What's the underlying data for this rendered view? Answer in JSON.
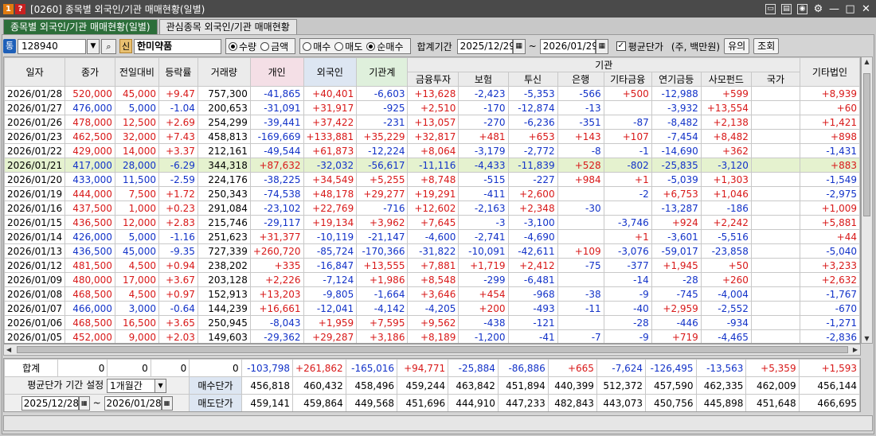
{
  "window": {
    "badge1": "1",
    "badge2": "?",
    "title": "[0260] 종목별 외국인/기관 매매현황(일별)"
  },
  "tabs": [
    {
      "label": "종목별 외국인/기관 매매현황(일별)"
    },
    {
      "label": "관심종목 외국인/기관 매매현황"
    }
  ],
  "toolbar": {
    "market_icon": "통",
    "code": "128940",
    "credit_badge": "신",
    "stock_name": "한미약품",
    "radio1": [
      {
        "label": "수량",
        "checked": true
      },
      {
        "label": "금액",
        "checked": false
      }
    ],
    "radio2": [
      {
        "label": "매수",
        "checked": false
      },
      {
        "label": "매도",
        "checked": false
      },
      {
        "label": "순매수",
        "checked": true
      }
    ],
    "period_label": "합계기간",
    "start_date": "2025/12/29",
    "tilde": "~",
    "end_date": "2026/01/29",
    "avg_price_check": "평균단가",
    "unit": "(주, 백만원)",
    "btn_caution": "유의",
    "btn_query": "조회"
  },
  "grid": {
    "headers": {
      "date": "일자",
      "close": "종가",
      "change": "전일대비",
      "rate": "등락률",
      "volume": "거래량",
      "individual": "개인",
      "foreign": "외국인",
      "institution": "기관계",
      "inst_group": "기관",
      "sub": [
        "금융투자",
        "보험",
        "투신",
        "은행",
        "기타금융",
        "연기금등",
        "사모펀드",
        "국가"
      ],
      "other_corp": "기타법인"
    },
    "rows": [
      {
        "date": "2026/01/28",
        "close": "520,000",
        "chg": "45,000",
        "rate": "+9.47",
        "vol": "757,300",
        "ind": "-41,865",
        "for": "+40,401",
        "inst": "-6,603",
        "fin": "+13,628",
        "ins": "-2,423",
        "inv": "-5,353",
        "bank": "-566",
        "ofin": "+500",
        "pen": "-12,988",
        "pef": "+599",
        "gov": "",
        "corp": "+8,939"
      },
      {
        "date": "2026/01/27",
        "close": "476,000",
        "chg": "5,000",
        "rate": "-1.04",
        "vol": "200,653",
        "ind": "-31,091",
        "for": "+31,917",
        "inst": "-925",
        "fin": "+2,510",
        "ins": "-170",
        "inv": "-12,874",
        "bank": "-13",
        "ofin": "",
        "pen": "-3,932",
        "pef": "+13,554",
        "gov": "",
        "corp": "+60"
      },
      {
        "date": "2026/01/26",
        "close": "478,000",
        "chg": "12,500",
        "rate": "+2.69",
        "vol": "254,299",
        "ind": "-39,441",
        "for": "+37,422",
        "inst": "-231",
        "fin": "+13,057",
        "ins": "-270",
        "inv": "-6,236",
        "bank": "-351",
        "ofin": "-87",
        "pen": "-8,482",
        "pef": "+2,138",
        "gov": "",
        "corp": "+1,421"
      },
      {
        "date": "2026/01/23",
        "close": "462,500",
        "chg": "32,000",
        "rate": "+7.43",
        "vol": "458,813",
        "ind": "-169,669",
        "for": "+133,881",
        "inst": "+35,229",
        "fin": "+32,817",
        "ins": "+481",
        "inv": "+653",
        "bank": "+143",
        "ofin": "+107",
        "pen": "-7,454",
        "pef": "+8,482",
        "gov": "",
        "corp": "+898"
      },
      {
        "date": "2026/01/22",
        "close": "429,000",
        "chg": "14,000",
        "rate": "+3.37",
        "vol": "212,161",
        "ind": "-49,544",
        "for": "+61,873",
        "inst": "-12,224",
        "fin": "+8,064",
        "ins": "-3,179",
        "inv": "-2,772",
        "bank": "-8",
        "ofin": "-1",
        "pen": "-14,690",
        "pef": "+362",
        "gov": "",
        "corp": "-1,431"
      },
      {
        "date": "2026/01/21",
        "close": "417,000",
        "chg": "28,000",
        "rate": "-6.29",
        "vol": "344,318",
        "ind": "+87,632",
        "for": "-32,032",
        "inst": "-56,617",
        "fin": "-11,116",
        "ins": "-4,433",
        "inv": "-11,839",
        "bank": "+528",
        "ofin": "-802",
        "pen": "-25,835",
        "pef": "-3,120",
        "gov": "",
        "corp": "+883"
      },
      {
        "date": "2026/01/20",
        "close": "433,000",
        "chg": "11,500",
        "rate": "-2.59",
        "vol": "224,176",
        "ind": "-38,225",
        "for": "+34,549",
        "inst": "+5,255",
        "fin": "+8,748",
        "ins": "-515",
        "inv": "-227",
        "bank": "+984",
        "ofin": "+1",
        "pen": "-5,039",
        "pef": "+1,303",
        "gov": "",
        "corp": "-1,549"
      },
      {
        "date": "2026/01/19",
        "close": "444,000",
        "chg": "7,500",
        "rate": "+1.72",
        "vol": "250,343",
        "ind": "-74,538",
        "for": "+48,178",
        "inst": "+29,277",
        "fin": "+19,291",
        "ins": "-411",
        "inv": "+2,600",
        "bank": "",
        "ofin": "-2",
        "pen": "+6,753",
        "pef": "+1,046",
        "gov": "",
        "corp": "-2,975"
      },
      {
        "date": "2026/01/16",
        "close": "437,500",
        "chg": "1,000",
        "rate": "+0.23",
        "vol": "291,084",
        "ind": "-23,102",
        "for": "+22,769",
        "inst": "-716",
        "fin": "+12,602",
        "ins": "-2,163",
        "inv": "+2,348",
        "bank": "-30",
        "ofin": "",
        "pen": "-13,287",
        "pef": "-186",
        "gov": "",
        "corp": "+1,009"
      },
      {
        "date": "2026/01/15",
        "close": "436,500",
        "chg": "12,000",
        "rate": "+2.83",
        "vol": "215,746",
        "ind": "-29,117",
        "for": "+19,134",
        "inst": "+3,962",
        "fin": "+7,645",
        "ins": "-3",
        "inv": "-3,100",
        "bank": "",
        "ofin": "-3,746",
        "pen": "+924",
        "pef": "+2,242",
        "gov": "",
        "corp": "+5,881"
      },
      {
        "date": "2026/01/14",
        "close": "426,000",
        "chg": "5,000",
        "rate": "-1.16",
        "vol": "251,623",
        "ind": "+31,377",
        "for": "-10,119",
        "inst": "-21,147",
        "fin": "-4,600",
        "ins": "-2,741",
        "inv": "-4,690",
        "bank": "",
        "ofin": "+1",
        "pen": "-3,601",
        "pef": "-5,516",
        "gov": "",
        "corp": "+44"
      },
      {
        "date": "2026/01/13",
        "close": "436,500",
        "chg": "45,000",
        "rate": "-9.35",
        "vol": "727,339",
        "ind": "+260,720",
        "for": "-85,724",
        "inst": "-170,366",
        "fin": "-31,822",
        "ins": "-10,091",
        "inv": "-42,611",
        "bank": "+109",
        "ofin": "-3,076",
        "pen": "-59,017",
        "pef": "-23,858",
        "gov": "",
        "corp": "-5,040"
      },
      {
        "date": "2026/01/12",
        "close": "481,500",
        "chg": "4,500",
        "rate": "+0.94",
        "vol": "238,202",
        "ind": "+335",
        "for": "-16,847",
        "inst": "+13,555",
        "fin": "+7,881",
        "ins": "+1,719",
        "inv": "+2,412",
        "bank": "-75",
        "ofin": "-377",
        "pen": "+1,945",
        "pef": "+50",
        "gov": "",
        "corp": "+3,233"
      },
      {
        "date": "2026/01/09",
        "close": "480,000",
        "chg": "17,000",
        "rate": "+3.67",
        "vol": "203,128",
        "ind": "+2,226",
        "for": "-7,124",
        "inst": "+1,986",
        "fin": "+8,548",
        "ins": "-299",
        "inv": "-6,481",
        "bank": "",
        "ofin": "-14",
        "pen": "-28",
        "pef": "+260",
        "gov": "",
        "corp": "+2,632"
      },
      {
        "date": "2026/01/08",
        "close": "468,500",
        "chg": "4,500",
        "rate": "+0.97",
        "vol": "152,913",
        "ind": "+13,203",
        "for": "-9,805",
        "inst": "-1,664",
        "fin": "+3,646",
        "ins": "+454",
        "inv": "-968",
        "bank": "-38",
        "ofin": "-9",
        "pen": "-745",
        "pef": "-4,004",
        "gov": "",
        "corp": "-1,767"
      },
      {
        "date": "2026/01/07",
        "close": "466,000",
        "chg": "3,000",
        "rate": "-0.64",
        "vol": "144,239",
        "ind": "+16,661",
        "for": "-12,041",
        "inst": "-4,142",
        "fin": "-4,205",
        "ins": "+200",
        "inv": "-493",
        "bank": "-11",
        "ofin": "-40",
        "pen": "+2,959",
        "pef": "-2,552",
        "gov": "",
        "corp": "-670"
      },
      {
        "date": "2026/01/06",
        "close": "468,500",
        "chg": "16,500",
        "rate": "+3.65",
        "vol": "250,945",
        "ind": "-8,043",
        "for": "+1,959",
        "inst": "+7,595",
        "fin": "+9,562",
        "ins": "-438",
        "inv": "-121",
        "bank": "",
        "ofin": "-28",
        "pen": "-446",
        "pef": "-934",
        "gov": "",
        "corp": "-1,271"
      },
      {
        "date": "2026/01/05",
        "close": "452,000",
        "chg": "9,000",
        "rate": "+2.03",
        "vol": "149,603",
        "ind": "-29,362",
        "for": "+29,287",
        "inst": "+3,186",
        "fin": "+8,189",
        "ins": "-1,200",
        "inv": "-41",
        "bank": "-7",
        "ofin": "-9",
        "pen": "+719",
        "pef": "-4,465",
        "gov": "",
        "corp": "-2,836"
      }
    ],
    "selected_row": 5
  },
  "summary": {
    "label": "합계",
    "close": "0",
    "chg": "0",
    "rate": "0",
    "vol": "0",
    "ind": "-103,798",
    "for": "+261,862",
    "inst": "-165,016",
    "fin": "+94,771",
    "ins": "-25,884",
    "inv": "-86,886",
    "bank": "+665",
    "ofin": "-7,624",
    "pen": "-126,495",
    "pef": "-13,563",
    "gov": "+5,359",
    "corp": "+1,593"
  },
  "avg_price": {
    "period_label": "평균단가 기간 설정",
    "period_value": "1개월간",
    "start": "2025/12/28",
    "tilde": "~",
    "end": "2026/01/28",
    "buy_label": "매수단가",
    "sell_label": "매도단가",
    "buy": [
      "456,818",
      "460,432",
      "458,496",
      "459,244",
      "463,842",
      "451,894",
      "440,399",
      "512,372",
      "457,590",
      "462,335",
      "462,009",
      "456,144"
    ],
    "sell": [
      "459,141",
      "459,864",
      "449,568",
      "451,696",
      "444,910",
      "447,233",
      "482,843",
      "443,073",
      "450,756",
      "445,898",
      "451,648",
      "466,695"
    ]
  },
  "colors": {
    "positive": "#d81818",
    "negative": "#1232c8",
    "active_tab": "#2c6e3a",
    "selected_row": "#e5f2cf"
  },
  "icons": [
    "window-icon",
    "print-icon",
    "capture-icon",
    "settings-icon",
    "minimize-icon",
    "maximize-icon",
    "close-icon"
  ]
}
